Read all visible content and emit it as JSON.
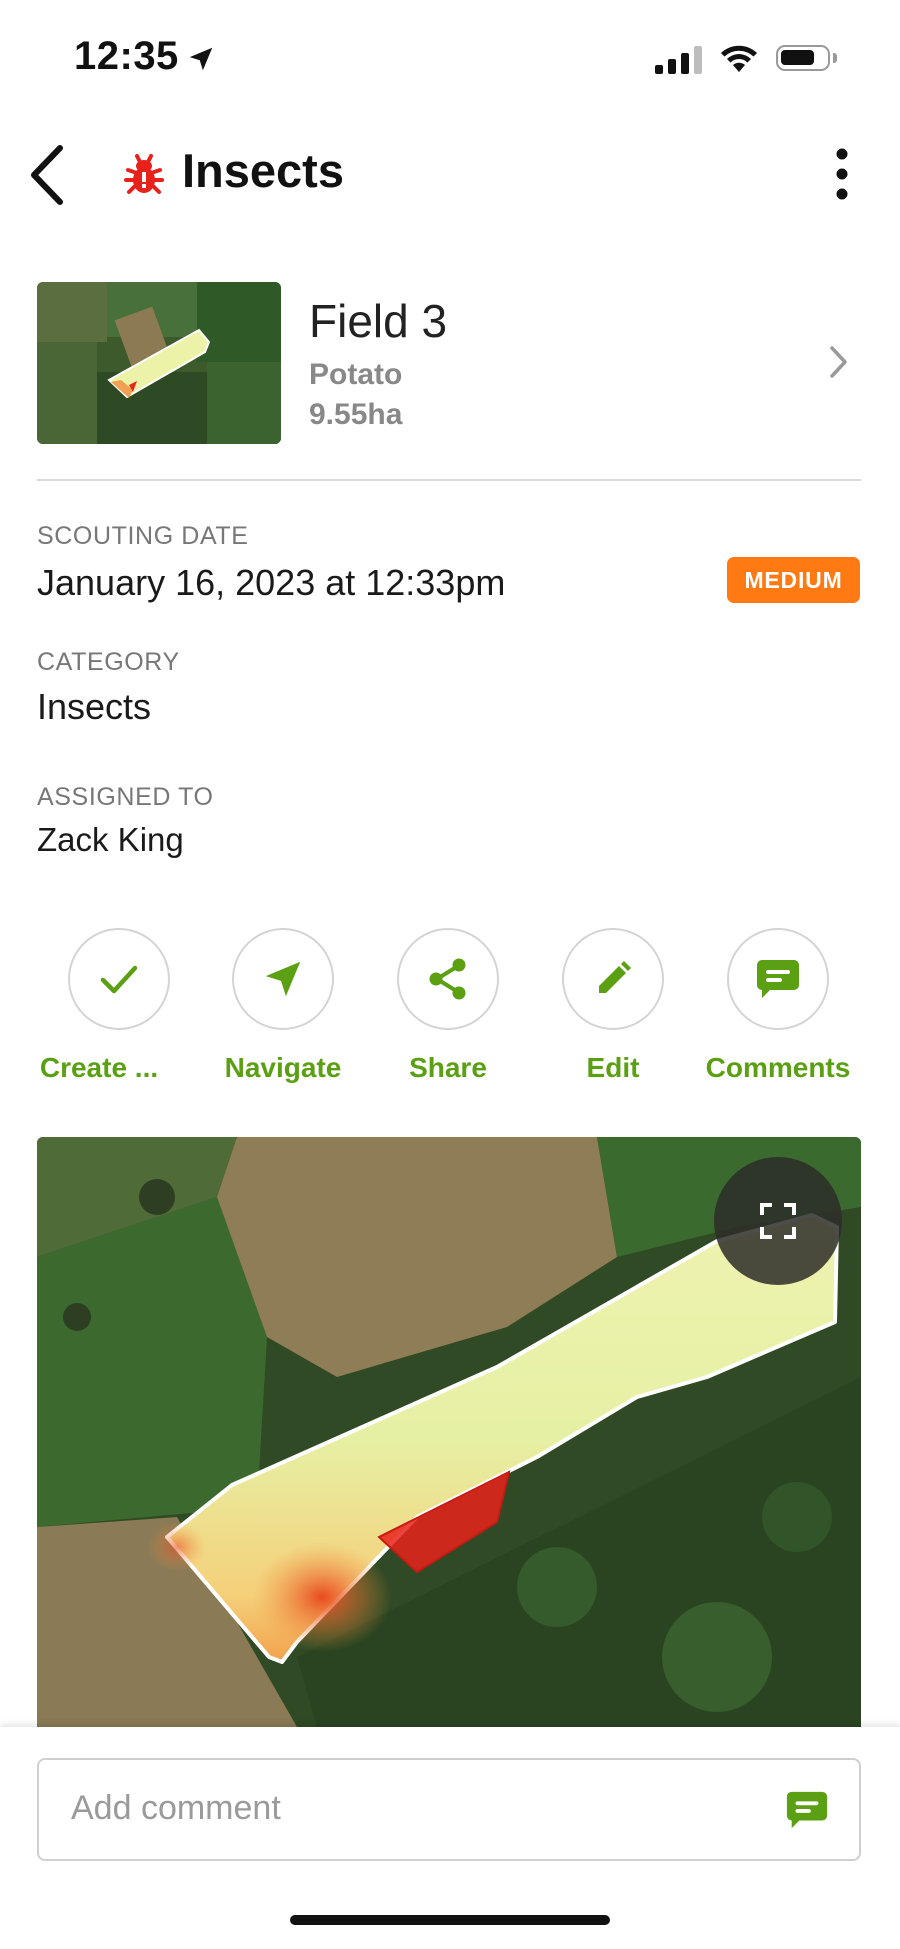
{
  "status_bar": {
    "time": "12:35"
  },
  "header": {
    "title": "Insects"
  },
  "field": {
    "name": "Field 3",
    "crop": "Potato",
    "area": "9.55ha"
  },
  "details": {
    "scouting_date_label": "SCOUTING DATE",
    "scouting_date": "January 16, 2023 at 12:33pm",
    "severity_badge": "MEDIUM",
    "category_label": "CATEGORY",
    "category": "Insects",
    "assigned_label": "ASSIGNED TO",
    "assigned_to": "Zack King"
  },
  "actions": [
    {
      "label": "Create ...",
      "icon": "check-icon"
    },
    {
      "label": "Navigate",
      "icon": "navigation-arrow-icon"
    },
    {
      "label": "Share",
      "icon": "share-icon"
    },
    {
      "label": "Edit",
      "icon": "pencil-icon"
    },
    {
      "label": "Comments",
      "icon": "comment-bubble-icon"
    }
  ],
  "comment": {
    "placeholder": "Add comment"
  },
  "colors": {
    "accent_green": "#5aa012",
    "badge_orange": "#ff7a12",
    "alert_red": "#e8221b"
  }
}
